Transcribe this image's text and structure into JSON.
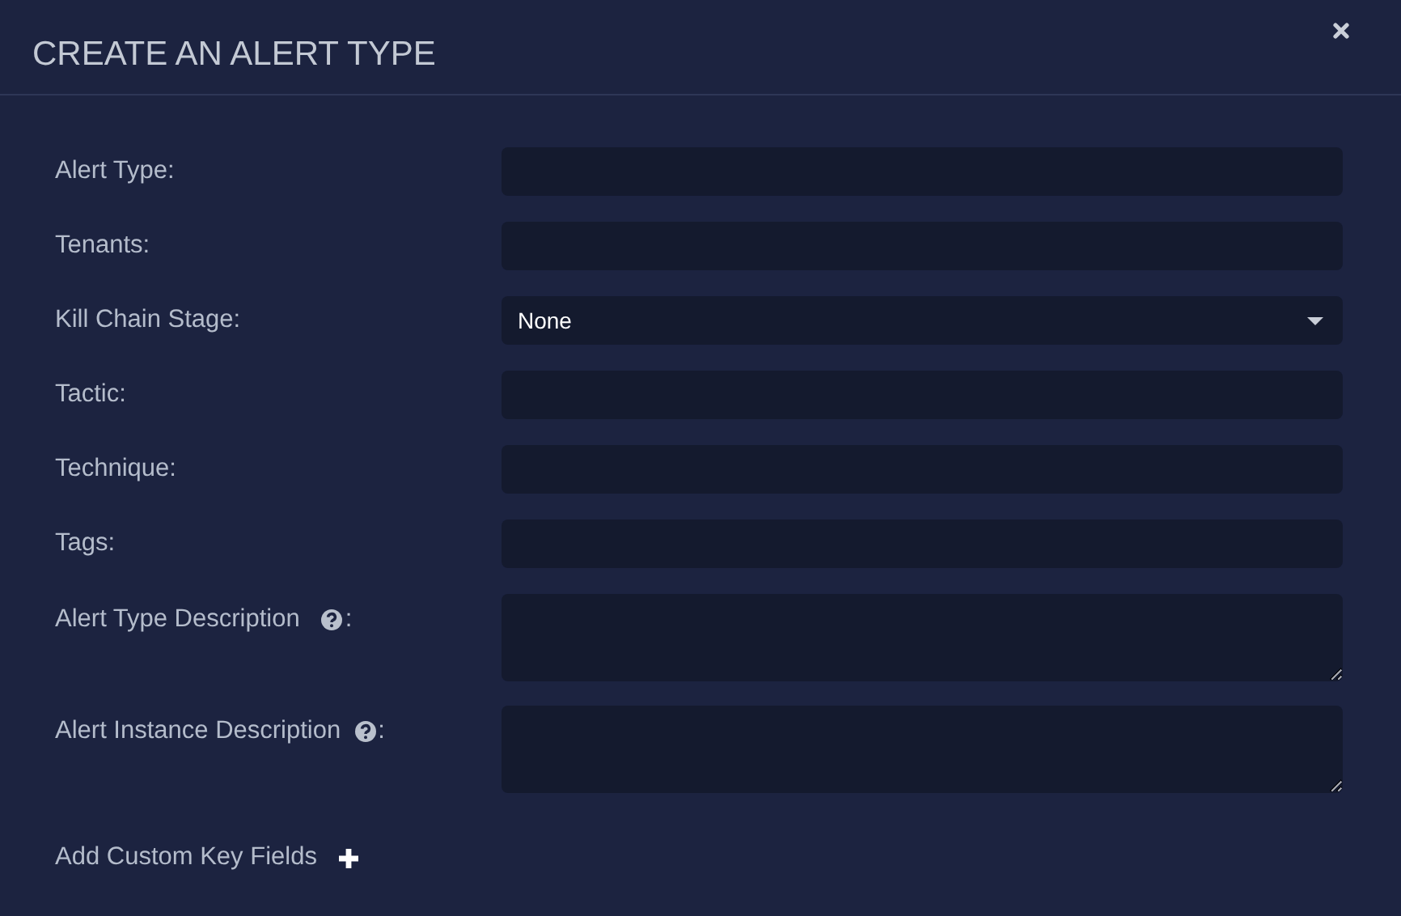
{
  "dialog": {
    "title": "CREATE AN ALERT TYPE"
  },
  "fields": [
    {
      "kind": "text",
      "label": "Alert Type:"
    },
    {
      "kind": "text",
      "label": "Tenants:"
    },
    {
      "kind": "select",
      "label": "Kill Chain Stage:",
      "value": "None"
    },
    {
      "kind": "text",
      "label": "Tactic:"
    },
    {
      "kind": "text",
      "label": "Technique:"
    },
    {
      "kind": "text",
      "label": "Tags:"
    },
    {
      "kind": "textarea",
      "label": "Alert Type Description",
      "help": true,
      "suffix": ":"
    },
    {
      "kind": "textarea",
      "label": "Alert Instance Description",
      "help": true,
      "suffix": ":"
    }
  ],
  "add_link": {
    "label": "Add Custom Key Fields"
  }
}
